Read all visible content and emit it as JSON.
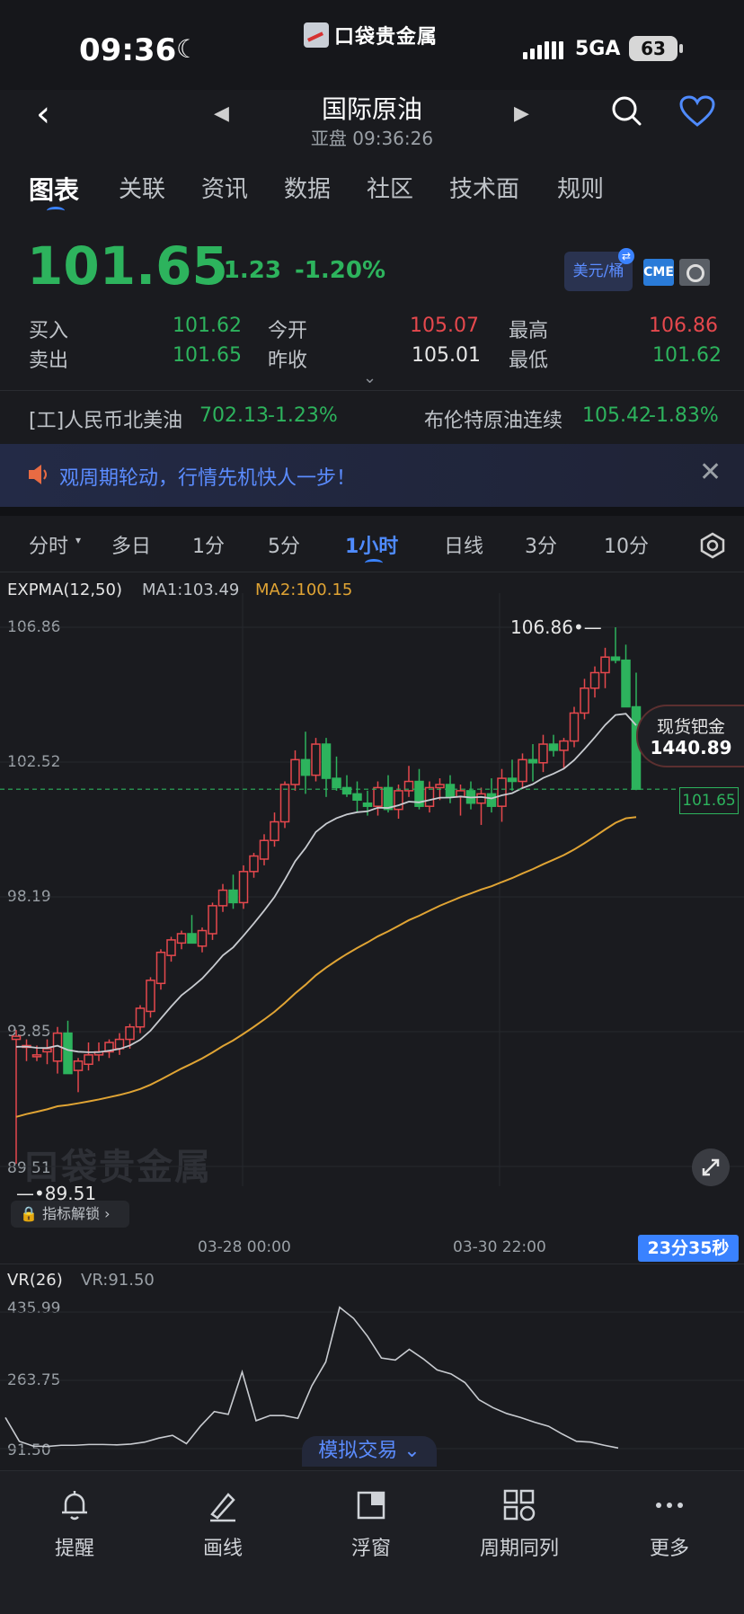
{
  "status_bar": {
    "time": "09:36",
    "brand": "口袋贵金属",
    "network": "5GA",
    "battery": "63"
  },
  "header": {
    "title": "国际原油",
    "subtitle": "亚盘 09:36:26"
  },
  "tabs": [
    "图表",
    "关联",
    "资讯",
    "数据",
    "社区",
    "技术面",
    "规则"
  ],
  "quote": {
    "price": "101.65",
    "change": "-1.23",
    "change_pct": "-1.20%",
    "unit": "美元/桶",
    "exchange": "CME",
    "buy_label": "买入",
    "buy": "101.62",
    "sell_label": "卖出",
    "sell": "101.65",
    "open_label": "今开",
    "open": "105.07",
    "prev_label": "昨收",
    "prev": "105.01",
    "high_label": "最高",
    "high": "106.86",
    "low_label": "最低",
    "low": "101.62"
  },
  "related": {
    "left_name": "[工]人民币北美油",
    "left_price": "702.13",
    "left_pct": "-1.23%",
    "right_name": "布伦特原油连续",
    "right_price": "105.42",
    "right_pct": "-1.83%"
  },
  "banner": {
    "text": "观周期轮动，行情先机快人一步！"
  },
  "periods": [
    "分时",
    "多日",
    "1分",
    "5分",
    "1小时",
    "日线",
    "3分",
    "10分"
  ],
  "indicator": {
    "name": "EXPMA(12,50)",
    "ma1": "MA1:103.49",
    "ma2": "MA2:100.15"
  },
  "chart_data": {
    "type": "candlestick",
    "y_ticks": [
      "106.86",
      "102.52",
      "98.19",
      "93.85",
      "89.51"
    ],
    "ylim": [
      89.51,
      106.86
    ],
    "x_ticks": [
      "03-28 00:00",
      "03-30 22:00"
    ],
    "high_label": "106.86",
    "low_label": "89.51",
    "last_price": "101.65",
    "candles": [
      [
        93.6,
        93.9,
        89.6,
        93.7
      ],
      [
        93.4,
        93.6,
        92.9,
        93.4
      ],
      [
        93.1,
        93.4,
        92.9,
        93.1
      ],
      [
        93.2,
        93.6,
        92.8,
        93.3
      ],
      [
        92.9,
        94.0,
        92.5,
        93.8
      ],
      [
        93.8,
        94.2,
        92.5,
        92.5
      ],
      [
        92.6,
        93.0,
        91.9,
        92.9
      ],
      [
        92.8,
        93.5,
        92.6,
        93.1
      ],
      [
        93.1,
        93.5,
        92.9,
        93.2
      ],
      [
        93.2,
        93.6,
        93.0,
        93.5
      ],
      [
        93.3,
        93.8,
        93.1,
        93.6
      ],
      [
        93.6,
        94.1,
        93.3,
        94.0
      ],
      [
        94.0,
        94.7,
        93.8,
        94.6
      ],
      [
        94.5,
        95.6,
        94.3,
        95.5
      ],
      [
        95.4,
        96.5,
        95.2,
        96.4
      ],
      [
        96.3,
        96.9,
        96.1,
        96.8
      ],
      [
        96.7,
        97.1,
        96.5,
        97.0
      ],
      [
        97.0,
        97.6,
        96.8,
        96.7
      ],
      [
        96.6,
        97.2,
        96.4,
        97.1
      ],
      [
        97.0,
        98.0,
        96.8,
        97.9
      ],
      [
        97.9,
        98.6,
        97.7,
        98.4
      ],
      [
        98.4,
        98.9,
        97.8,
        98.0
      ],
      [
        98.0,
        99.2,
        97.8,
        99.0
      ],
      [
        99.0,
        99.6,
        98.8,
        99.5
      ],
      [
        99.4,
        100.2,
        99.2,
        100.0
      ],
      [
        100.0,
        100.9,
        99.8,
        100.6
      ],
      [
        100.6,
        101.9,
        100.4,
        101.8
      ],
      [
        101.8,
        102.9,
        101.6,
        102.6
      ],
      [
        102.6,
        103.5,
        101.5,
        102.1
      ],
      [
        102.1,
        103.3,
        101.9,
        103.1
      ],
      [
        103.1,
        103.3,
        101.4,
        102.0
      ],
      [
        102.0,
        102.7,
        101.6,
        101.7
      ],
      [
        101.7,
        102.1,
        101.4,
        101.5
      ],
      [
        101.5,
        101.9,
        100.9,
        101.3
      ],
      [
        101.2,
        101.6,
        100.8,
        101.1
      ],
      [
        101.1,
        101.9,
        100.8,
        101.7
      ],
      [
        101.7,
        102.1,
        100.9,
        101.0
      ],
      [
        101.0,
        101.8,
        100.7,
        101.6
      ],
      [
        101.6,
        102.4,
        101.4,
        101.9
      ],
      [
        101.9,
        102.3,
        101.0,
        101.1
      ],
      [
        101.1,
        101.9,
        100.9,
        101.7
      ],
      [
        101.7,
        102.0,
        101.3,
        101.8
      ],
      [
        101.8,
        102.1,
        101.2,
        101.4
      ],
      [
        101.4,
        101.8,
        100.8,
        101.6
      ],
      [
        101.6,
        101.9,
        101.0,
        101.2
      ],
      [
        101.2,
        101.7,
        100.5,
        101.5
      ],
      [
        101.5,
        102.0,
        100.9,
        101.1
      ],
      [
        101.1,
        102.3,
        100.6,
        102.0
      ],
      [
        102.0,
        102.6,
        101.6,
        101.9
      ],
      [
        101.9,
        102.8,
        101.7,
        102.6
      ],
      [
        102.6,
        103.1,
        101.9,
        102.5
      ],
      [
        102.5,
        103.4,
        102.2,
        103.1
      ],
      [
        103.1,
        103.4,
        102.7,
        102.9
      ],
      [
        102.9,
        103.3,
        102.3,
        103.2
      ],
      [
        103.2,
        104.3,
        103.0,
        104.1
      ],
      [
        104.1,
        105.2,
        103.9,
        104.9
      ],
      [
        104.9,
        105.6,
        104.6,
        105.4
      ],
      [
        105.4,
        106.2,
        104.9,
        105.9
      ],
      [
        105.9,
        106.86,
        105.7,
        105.8
      ],
      [
        105.8,
        106.3,
        104.3,
        104.3
      ],
      [
        104.3,
        105.4,
        101.62,
        101.65
      ]
    ]
  },
  "callout": {
    "name": "现货钯金",
    "value": "1440.89"
  },
  "watermark": "口袋贵金属",
  "unlock": "指标解锁",
  "countdown": "23分35秒",
  "vr": {
    "name": "VR(26)",
    "value": "VR:91.50",
    "y_ticks": [
      "435.99",
      "263.75",
      "91.50"
    ]
  },
  "sim_trade": "模拟交易",
  "bottom_bar": [
    "提醒",
    "画线",
    "浮窗",
    "周期同列",
    "更多"
  ]
}
